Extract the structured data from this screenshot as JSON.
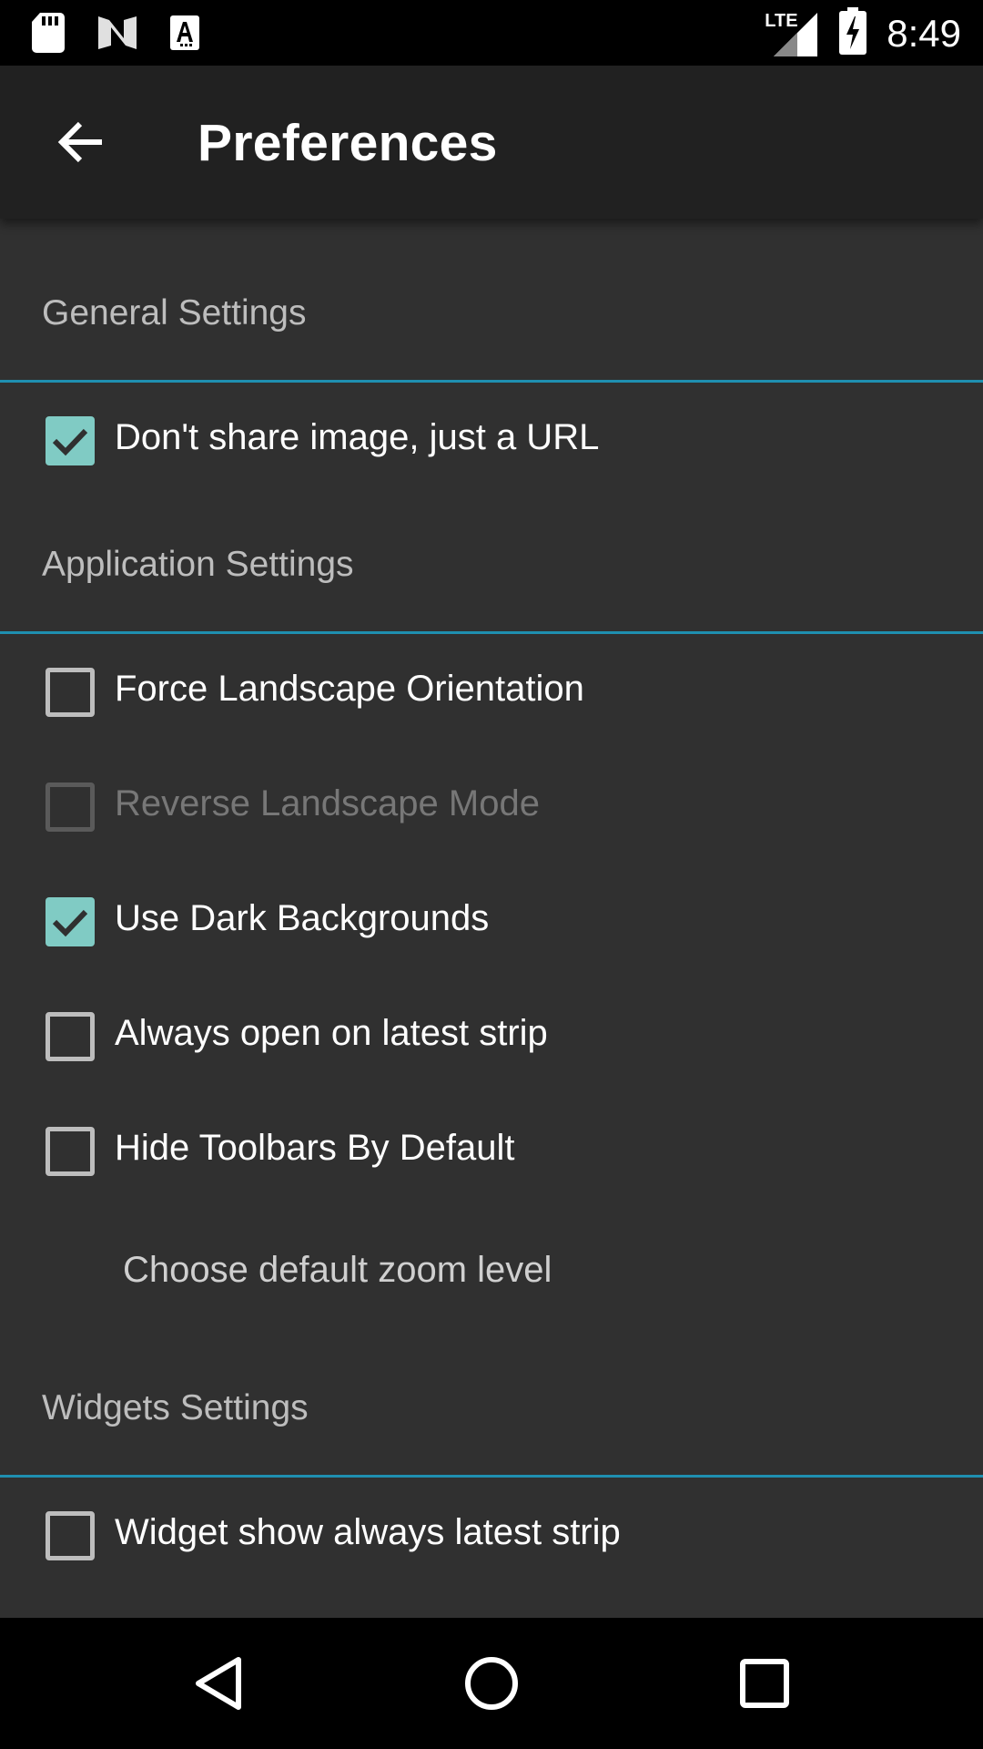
{
  "status_bar": {
    "time": "8:49",
    "network": "LTE"
  },
  "app_bar": {
    "title": "Preferences"
  },
  "sections": {
    "general": {
      "title": "General Settings",
      "items": [
        {
          "label": "Don't share image, just a URL",
          "checked": true,
          "enabled": true
        }
      ]
    },
    "application": {
      "title": "Application Settings",
      "items": [
        {
          "label": "Force Landscape Orientation",
          "checked": false,
          "enabled": true
        },
        {
          "label": "Reverse Landscape Mode",
          "checked": false,
          "enabled": false
        },
        {
          "label": "Use Dark Backgrounds",
          "checked": true,
          "enabled": true
        },
        {
          "label": "Always open on latest strip",
          "checked": false,
          "enabled": true
        },
        {
          "label": "Hide Toolbars By Default",
          "checked": false,
          "enabled": true
        }
      ],
      "zoom_label": "Choose default zoom level"
    },
    "widgets": {
      "title": "Widgets Settings",
      "items": [
        {
          "label": "Widget show always latest strip",
          "checked": false,
          "enabled": true
        }
      ]
    }
  },
  "colors": {
    "accent": "#80cbc4",
    "divider": "#1f8fb0",
    "background": "#303030",
    "app_bar": "#212121"
  }
}
